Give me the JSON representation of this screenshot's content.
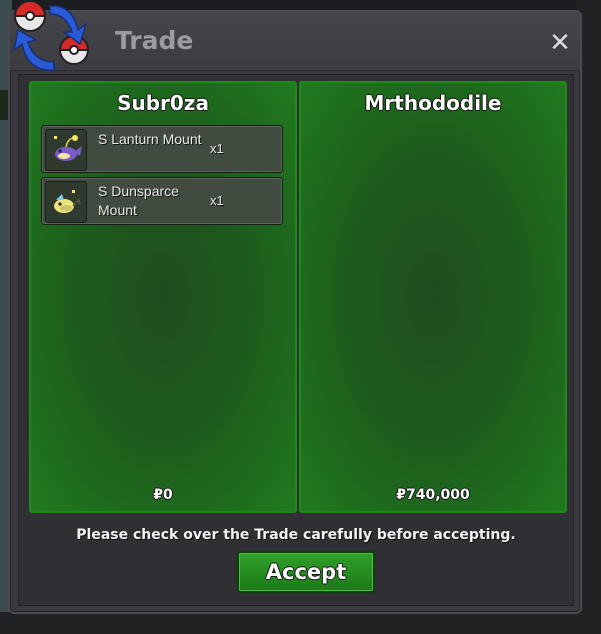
{
  "window": {
    "title": "Trade",
    "close_label": "✕"
  },
  "left_panel": {
    "player": "Subr0za",
    "items": [
      {
        "name": "S Lanturn Mount",
        "qty": "x1",
        "icon": "lanturn-sprite-icon"
      },
      {
        "name": "S Dunsparce Mount",
        "qty": "x1",
        "icon": "dunsparce-sprite-icon"
      }
    ],
    "money": "₽0"
  },
  "right_panel": {
    "player": "Mrthododile",
    "items": [],
    "money": "₽740,000"
  },
  "notice": "Please check over the Trade carefully before accepting.",
  "accept_label": "Accept",
  "colors": {
    "panel_green": "#1f6b1c",
    "button_green": "#2a9a25",
    "window_bg": "#3a3a40"
  }
}
